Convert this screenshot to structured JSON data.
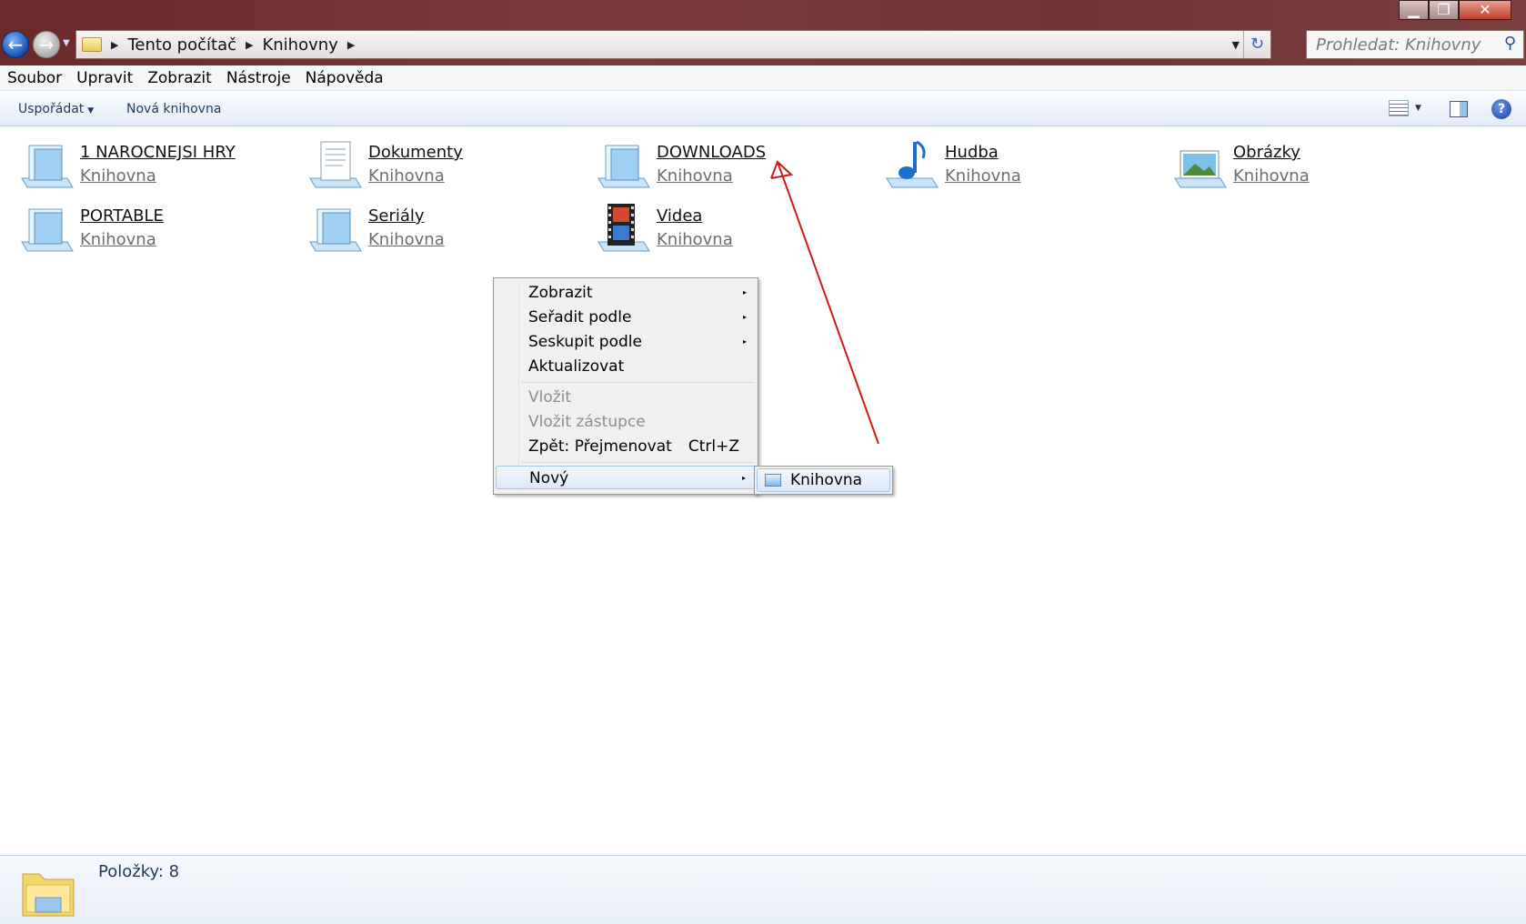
{
  "window": {
    "controls": {
      "minimize": "▁",
      "maximize": "❐",
      "close": "✕"
    }
  },
  "navigation": {
    "back_icon": "←",
    "forward_icon": "→",
    "history_dropdown": "▼"
  },
  "address": {
    "crumbs": [
      "Tento počítač",
      "Knihovny"
    ],
    "separator": "▶",
    "dropdown": "▼",
    "refresh": "↻"
  },
  "search": {
    "placeholder": "Prohledat: Knihovny",
    "icon": "⚲"
  },
  "menubar": {
    "items": [
      "Soubor",
      "Upravit",
      "Zobrazit",
      "Nástroje",
      "Nápověda"
    ]
  },
  "commandbar": {
    "organize": "Uspořádat",
    "organize_arrow": "▼",
    "new_library": "Nová knihovna",
    "views_arrow": "▼",
    "help": "?"
  },
  "libraries": [
    {
      "name": "1 NAROCNEJSI HRY",
      "type": "Knihovna",
      "icon": "generic-library"
    },
    {
      "name": "Dokumenty",
      "type": "Knihovna",
      "icon": "documents-library"
    },
    {
      "name": "DOWNLOADS",
      "type": "Knihovna",
      "icon": "generic-library"
    },
    {
      "name": "Hudba",
      "type": "Knihovna",
      "icon": "music-library"
    },
    {
      "name": "Obrázky",
      "type": "Knihovna",
      "icon": "pictures-library"
    },
    {
      "name": "PORTABLE",
      "type": "Knihovna",
      "icon": "generic-library"
    },
    {
      "name": "Seriály",
      "type": "Knihovna",
      "icon": "generic-library"
    },
    {
      "name": "Videa",
      "type": "Knihovna",
      "icon": "videos-library"
    }
  ],
  "context_menu": {
    "items": [
      {
        "label": "Zobrazit",
        "submenu": "▸"
      },
      {
        "label": "Seřadit podle",
        "submenu": "▸"
      },
      {
        "label": "Seskupit podle",
        "submenu": "▸"
      },
      {
        "label": "Aktualizovat"
      },
      {
        "label": "Vložit"
      },
      {
        "label": "Vložit zástupce"
      },
      {
        "label": "Zpět: Přejmenovat",
        "shortcut": "Ctrl+Z"
      },
      {
        "label": "Nový",
        "submenu": "▸"
      }
    ],
    "submenu_new": {
      "label": "Knihovna"
    }
  },
  "statusbar": {
    "count": "Položky: 8"
  },
  "colors": {
    "title_bar": "#6e3434",
    "annotation_arrow": "#cc1a1a",
    "link_gray": "#6d6d6d",
    "command_text": "#1e395b"
  }
}
